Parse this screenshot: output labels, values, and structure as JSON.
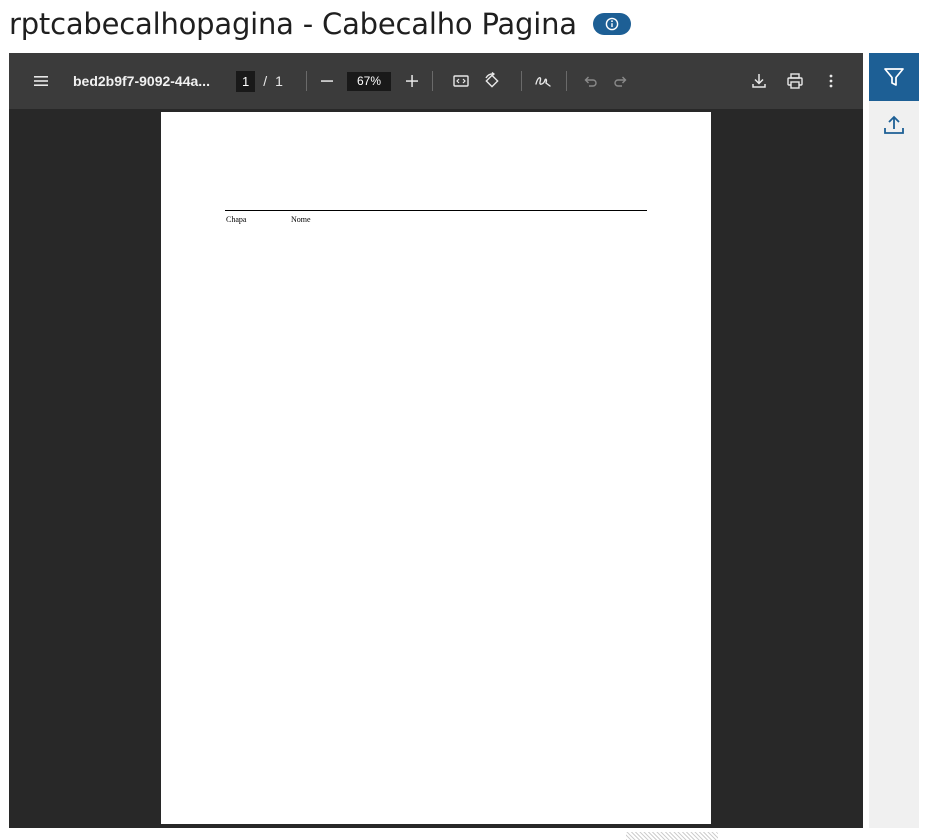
{
  "header": {
    "title": "rptcabecalhopagina - Cabecalho Pagina",
    "info_icon": "info-icon"
  },
  "viewer": {
    "toolbar": {
      "menu_icon": "hamburger-menu-icon",
      "file_name": "bed2b9f7-9092-44a...",
      "current_page": "1",
      "page_separator": "/",
      "total_pages": "1",
      "zoom_out_icon": "minus-icon",
      "zoom": "67%",
      "zoom_in_icon": "plus-icon",
      "fit_icon": "fit-to-page-icon",
      "rotate_icon": "rotate-icon",
      "annotate_icon": "draw-icon",
      "undo_icon": "undo-icon",
      "redo_icon": "redo-icon",
      "download_icon": "download-icon",
      "print_icon": "print-icon",
      "more_icon": "more-vertical-icon"
    },
    "document": {
      "columns": [
        "Chapa",
        "Nome"
      ]
    }
  },
  "sidebar": {
    "filter_icon": "filter-icon",
    "upload_icon": "upload-icon"
  },
  "colors": {
    "accent": "#1d5f95",
    "toolbar_bg": "#3b3b3b",
    "viewer_bg": "#282828",
    "sidebar_bg": "#f0f0f0"
  }
}
